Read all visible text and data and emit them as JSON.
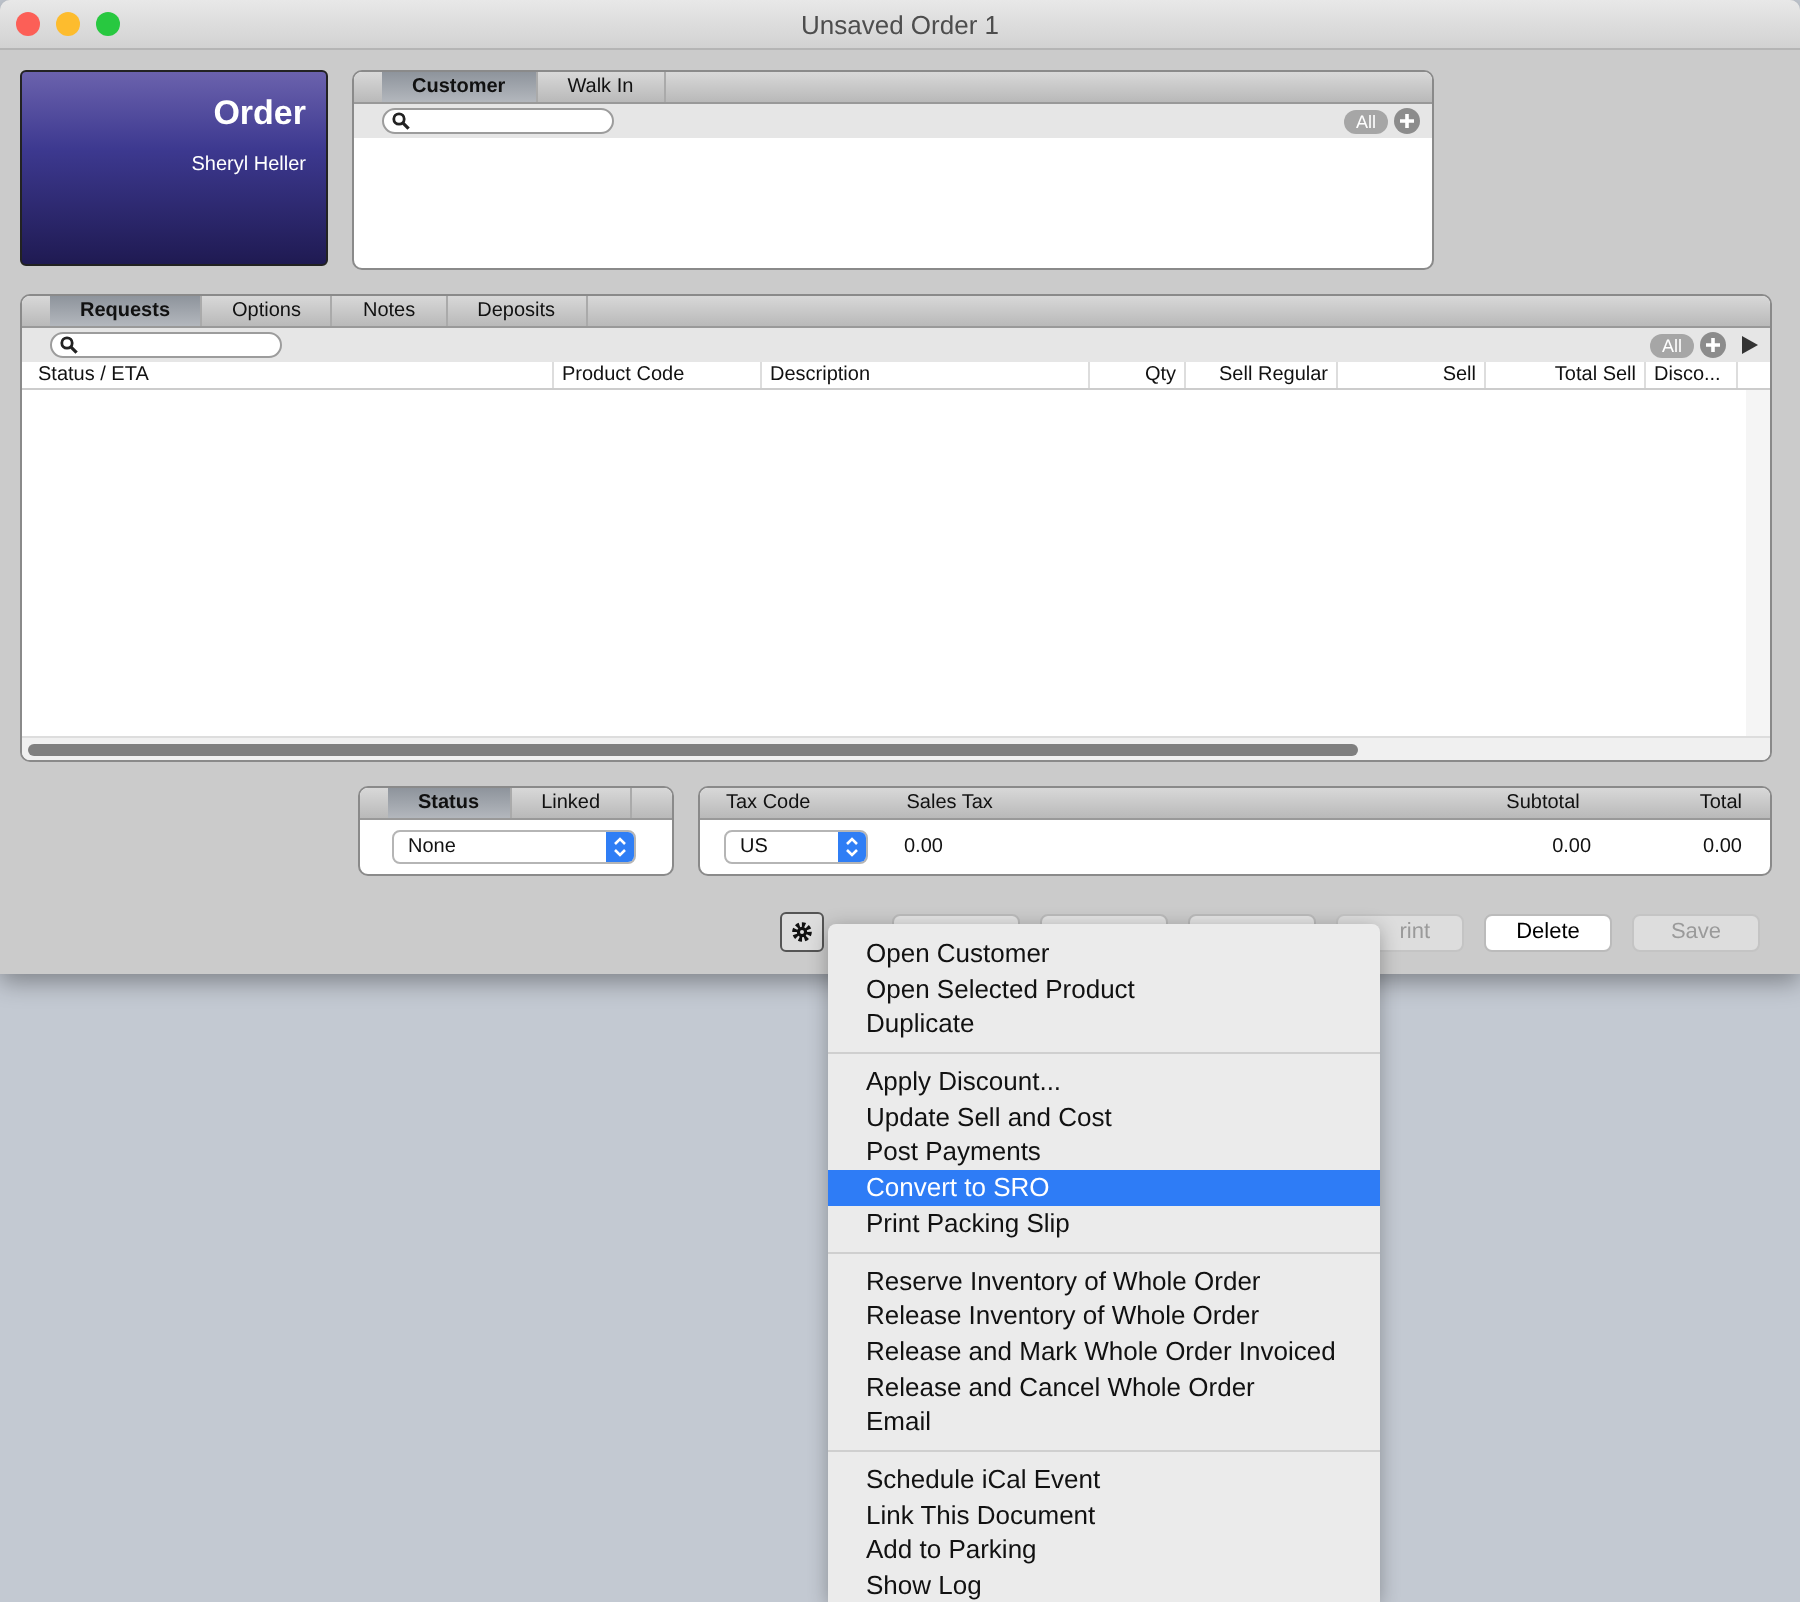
{
  "window": {
    "title": "Unsaved Order 1"
  },
  "header_card": {
    "title": "Order",
    "subtitle": "Sheryl Heller"
  },
  "customer_panel": {
    "tabs": [
      {
        "label": "Customer",
        "selected": true
      },
      {
        "label": "Walk In",
        "selected": false
      }
    ],
    "filter_badge": "All"
  },
  "requests_panel": {
    "tabs": [
      {
        "label": "Requests",
        "selected": true
      },
      {
        "label": "Options",
        "selected": false
      },
      {
        "label": "Notes",
        "selected": false
      },
      {
        "label": "Deposits",
        "selected": false
      }
    ],
    "filter_badge": "All",
    "columns": [
      "Status / ETA",
      "Product Code",
      "Description",
      "Qty",
      "Sell Regular",
      "Sell",
      "Total Sell",
      "Disco..."
    ]
  },
  "status_panel": {
    "tabs": [
      {
        "label": "Status",
        "selected": true
      },
      {
        "label": "Linked",
        "selected": false
      }
    ],
    "value": "None"
  },
  "totals_panel": {
    "tax_code_label": "Tax Code",
    "tax_code": "US",
    "sales_tax_label": "Sales Tax",
    "sales_tax": "0.00",
    "subtotal_label": "Subtotal",
    "subtotal": "0.00",
    "total_label": "Total",
    "total": "0.00"
  },
  "buttons": [
    {
      "kind": "blank"
    },
    {
      "kind": "blank"
    },
    {
      "kind": "blank"
    },
    {
      "kind": "button",
      "label": "rint",
      "disabled": true
    },
    {
      "kind": "button",
      "label": "Delete",
      "disabled": false
    },
    {
      "kind": "button",
      "label": "Save",
      "disabled": true
    }
  ],
  "action_menu": {
    "sections": [
      [
        {
          "label": "Open Customer",
          "selected": false
        },
        {
          "label": "Open Selected Product",
          "selected": false
        },
        {
          "label": "Duplicate",
          "selected": false
        }
      ],
      [
        {
          "label": "Apply Discount...",
          "selected": false
        },
        {
          "label": "Update Sell and Cost",
          "selected": false
        },
        {
          "label": "Post Payments",
          "selected": false
        },
        {
          "label": "Convert to SRO",
          "selected": true
        },
        {
          "label": "Print Packing Slip",
          "selected": false
        }
      ],
      [
        {
          "label": "Reserve Inventory of Whole Order",
          "selected": false
        },
        {
          "label": "Release Inventory of Whole Order",
          "selected": false
        },
        {
          "label": "Release and Mark Whole Order Invoiced",
          "selected": false
        },
        {
          "label": "Release and Cancel Whole Order",
          "selected": false
        },
        {
          "label": "Email",
          "selected": false
        }
      ],
      [
        {
          "label": "Schedule iCal Event",
          "selected": false
        },
        {
          "label": "Link This Document",
          "selected": false
        },
        {
          "label": "Add to Parking",
          "selected": false
        },
        {
          "label": "Show Log",
          "selected": false
        }
      ]
    ]
  }
}
